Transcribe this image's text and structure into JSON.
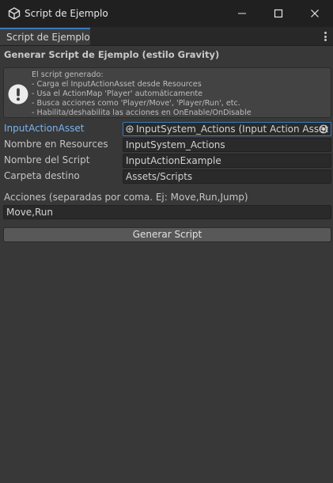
{
  "window": {
    "title": "Script de Ejemplo"
  },
  "tab": {
    "label": "Script de Ejemplo"
  },
  "heading": "Generar Script de Ejemplo (estilo Gravity)",
  "help": {
    "lines": [
      "El script generado:",
      "- Carga el InputActionAsset desde Resources",
      "- Usa el ActionMap 'Player' automáticamente",
      "- Busca acciones como 'Player/Move', 'Player/Run', etc.",
      "- Habilita/deshabilita las acciones en OnEnable/OnDisable"
    ]
  },
  "fields": {
    "input_action_asset": {
      "label": "InputActionAsset",
      "value": "InputSystem_Actions (Input Action Asset"
    },
    "resources_name": {
      "label": "Nombre en Resources",
      "value": "InputSystem_Actions"
    },
    "script_name": {
      "label": "Nombre del Script",
      "value": "InputActionExample"
    },
    "target_folder": {
      "label": "Carpeta destino",
      "value": "Assets/Scripts"
    }
  },
  "actions": {
    "label": "Acciones (separadas por coma. Ej: Move,Run,Jump)",
    "value": "Move,Run"
  },
  "generate_button": "Generar Script",
  "icons": {
    "app": "unity-logo-icon",
    "minimize": "minimize-icon",
    "maximize": "maximize-icon",
    "close": "close-icon",
    "menu": "kebab-menu-icon",
    "help": "warning-exclamation-icon",
    "asset": "input-action-asset-icon",
    "picker": "object-picker-icon"
  }
}
